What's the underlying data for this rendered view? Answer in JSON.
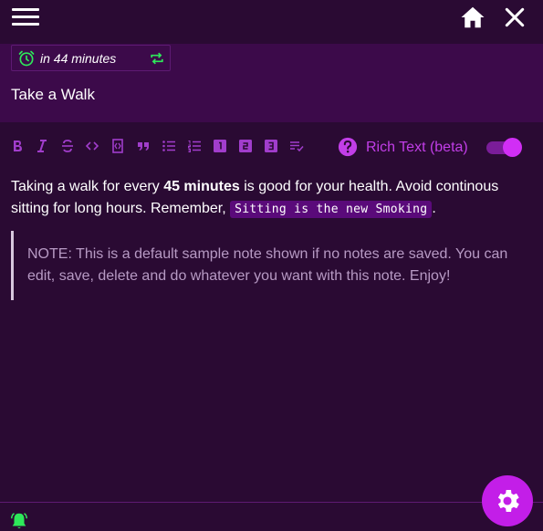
{
  "header": {
    "menu_icon": "hamburger-menu-icon",
    "home_icon": "home-icon",
    "close_icon": "close-icon"
  },
  "note": {
    "reminder_text": "in 44 minutes",
    "title": "Take a Walk",
    "body": {
      "p1_before": "Taking a walk for every ",
      "p1_bold": "45 minutes",
      "p1_middle": " is good for your health. Avoid continous sitting for long hours. Remember, ",
      "p1_code": "Sitting is the new Smoking",
      "p1_after": ".",
      "quote": "NOTE: This is a default sample note shown if no notes are saved. You can edit, save, delete and do whatever you want with this note. Enjoy!"
    }
  },
  "toolbar": {
    "items": [
      {
        "name": "bold",
        "glyph": "B"
      },
      {
        "name": "italic",
        "glyph": "I"
      },
      {
        "name": "strikethrough",
        "glyph": "S"
      },
      {
        "name": "code",
        "glyph": "<>"
      },
      {
        "name": "code-block",
        "glyph": "{}"
      },
      {
        "name": "blockquote",
        "glyph": "”"
      },
      {
        "name": "bulleted-list",
        "glyph": "list"
      },
      {
        "name": "numbered-list",
        "glyph": "list-num"
      },
      {
        "name": "heading-1",
        "glyph": "1"
      },
      {
        "name": "heading-2",
        "glyph": "2"
      },
      {
        "name": "heading-3",
        "glyph": "3"
      },
      {
        "name": "text-format",
        "glyph": "format"
      }
    ],
    "rich_text_label": "Rich Text (beta)",
    "rich_text_enabled": true
  },
  "footer": {
    "bell_icon": "bell-icon",
    "settings_icon": "gear-icon"
  },
  "colors": {
    "background": "#2a0a33",
    "title_area": "#3c0a4a",
    "accent": "#c31ee8",
    "toolbar_icon": "#a13dcc",
    "reminder_green": "#2ee85a"
  }
}
